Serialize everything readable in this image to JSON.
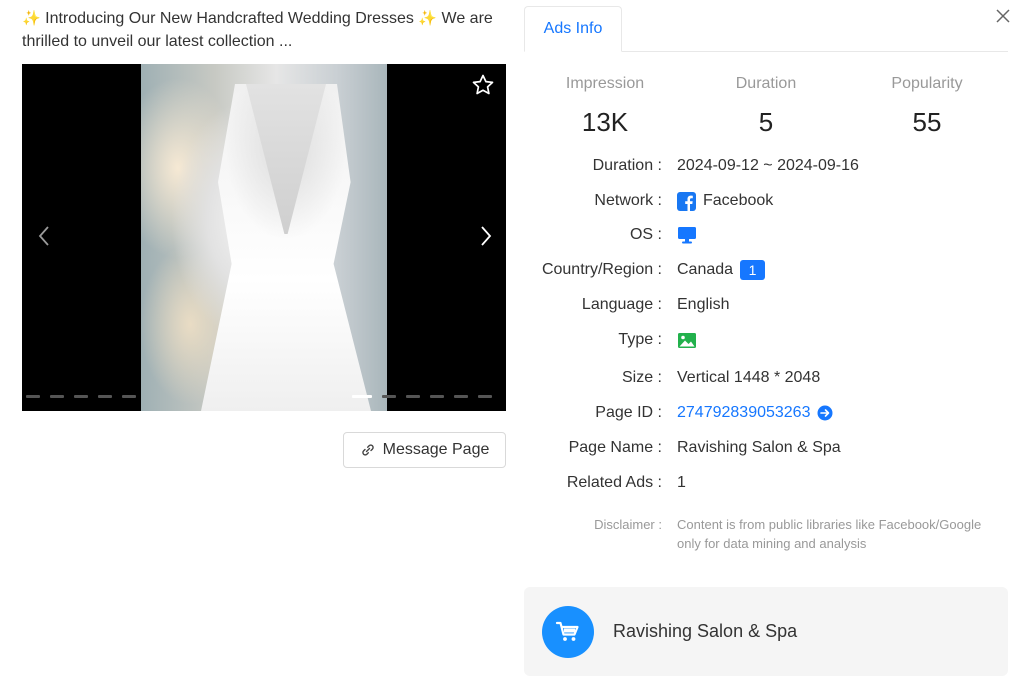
{
  "ad": {
    "text_line1": "Introducing Our New Handcrafted Wedding Dresses",
    "text_line1_after": "We are",
    "text_line2": "thrilled to unveil our latest collection ...",
    "spark_glyph": "✨"
  },
  "media": {
    "favorite_icon": "star-outline-icon",
    "prev_icon": "chevron-left-icon",
    "next_icon": "chevron-right-icon",
    "active_slide": 6
  },
  "message_button": {
    "label": "Message Page",
    "icon": "link-icon"
  },
  "tabs": [
    {
      "label": "Ads Info",
      "active": true
    }
  ],
  "stats": [
    {
      "label": "Impression",
      "value": "13K"
    },
    {
      "label": "Duration",
      "value": "5"
    },
    {
      "label": "Popularity",
      "value": "55"
    }
  ],
  "details": {
    "duration": {
      "key": "Duration :",
      "value": "2024-09-12 ~ 2024-09-16"
    },
    "network": {
      "key": "Network :",
      "value": "Facebook",
      "icon": "facebook-icon",
      "icon_color": "#1877f2"
    },
    "os": {
      "key": "OS :",
      "icon": "desktop-icon",
      "icon_color": "#1677ff"
    },
    "country": {
      "key": "Country/Region :",
      "value": "Canada",
      "badge": "1"
    },
    "language": {
      "key": "Language :",
      "value": "English"
    },
    "type": {
      "key": "Type :",
      "icon": "image-icon",
      "icon_color": "#22b14c"
    },
    "size": {
      "key": "Size :",
      "value": "Vertical 1448 * 2048"
    },
    "page_id": {
      "key": "Page ID :",
      "value": "274792839053263",
      "icon": "arrow-circle-right-icon"
    },
    "page_name": {
      "key": "Page Name :",
      "value": "Ravishing Salon & Spa"
    },
    "related_ads": {
      "key": "Related Ads :",
      "value": "1"
    }
  },
  "disclaimer": {
    "key": "Disclaimer :",
    "value": "Content is from public libraries like Facebook/Google only for data mining and analysis"
  },
  "page_card": {
    "name": "Ravishing Salon & Spa",
    "icon": "shopping-cart-icon",
    "icon_bg": "#1890ff"
  },
  "colors": {
    "accent": "#1677ff",
    "muted": "#999999"
  }
}
